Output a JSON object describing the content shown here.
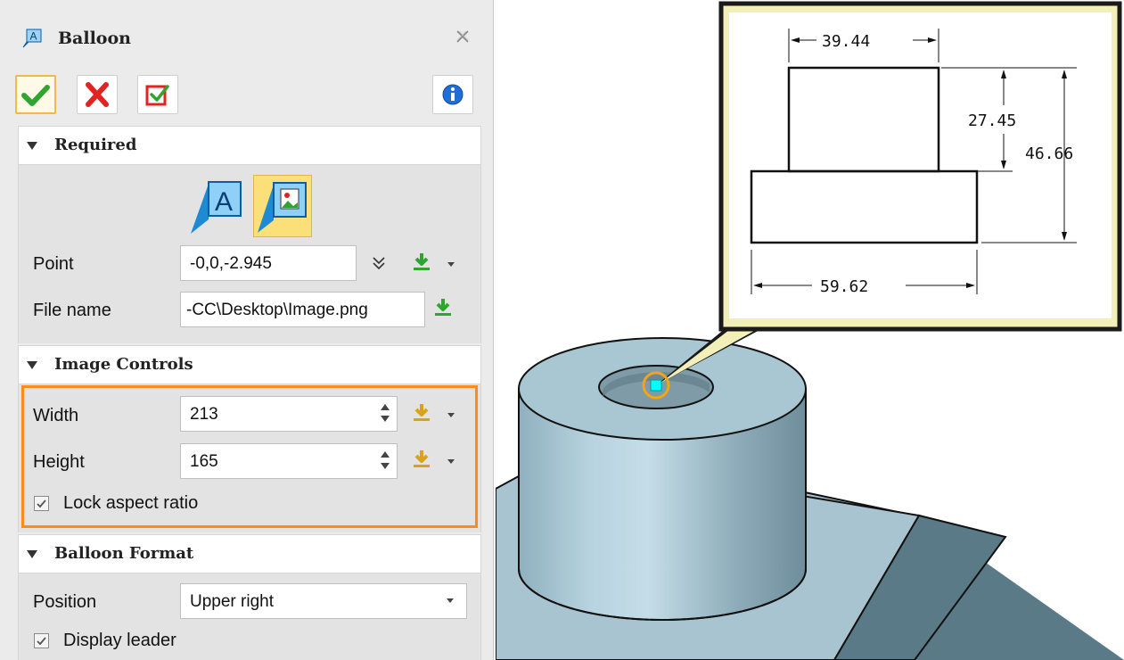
{
  "dialog": {
    "title": "Balloon",
    "icons": {
      "title": "balloon-text-icon",
      "close": "close-icon",
      "ok": "checkmark-icon",
      "cancel": "cross-icon",
      "apply": "apply-icon",
      "info": "info-icon"
    }
  },
  "sections": {
    "required": {
      "title": "Required",
      "modes": [
        "text-balloon-icon",
        "image-balloon-icon"
      ],
      "point_label": "Point",
      "point_value": "-0,0,-2.945",
      "file_label": "File name",
      "file_value": "-CC\\Desktop\\Image.png"
    },
    "image_controls": {
      "title": "Image Controls",
      "width_label": "Width",
      "width_value": "213",
      "height_label": "Height",
      "height_value": "165",
      "lock_label": "Lock aspect ratio",
      "lock_checked": true
    },
    "balloon_format": {
      "title": "Balloon Format",
      "position_label": "Position",
      "position_value": "Upper right",
      "leader_label": "Display leader",
      "leader_checked": true
    }
  },
  "colors": {
    "highlight": "#ff8c1a",
    "balloon_fill": "#f2f0b8",
    "part_fill": "#a9c6d3",
    "selected_point": "#00ffff"
  },
  "balloon_image": {
    "dimensions": [
      "39.44",
      "27.45",
      "46.66",
      "59.62"
    ]
  }
}
